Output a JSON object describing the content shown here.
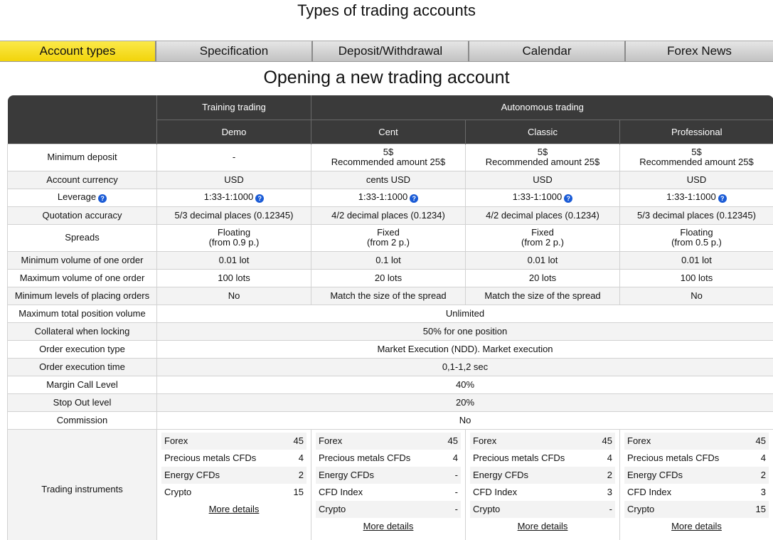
{
  "page_title": "Types of trading accounts",
  "tabs": [
    {
      "label": "Account types",
      "active": true
    },
    {
      "label": "Specification",
      "active": false
    },
    {
      "label": "Deposit/Withdrawal",
      "active": false
    },
    {
      "label": "Calendar",
      "active": false
    },
    {
      "label": "Forex News",
      "active": false
    }
  ],
  "section_title": "Opening a new trading account",
  "header": {
    "group_training": "Training trading",
    "group_autonomous": "Autonomous trading",
    "accounts": [
      "Demo",
      "Cent",
      "Classic",
      "Professional"
    ]
  },
  "rows": {
    "min_deposit": {
      "label": "Minimum deposit",
      "demo": "-",
      "cent_a": "5$",
      "cent_b": "Recommended amount 25$",
      "classic_a": "5$",
      "classic_b": "Recommended amount 25$",
      "pro_a": "5$",
      "pro_b": "Recommended amount 25$"
    },
    "currency": {
      "label": "Account currency",
      "demo": "USD",
      "cent": "cents USD",
      "classic": "USD",
      "pro": "USD"
    },
    "leverage": {
      "label": "Leverage",
      "demo": "1:33-1:1000",
      "cent": "1:33-1:1000",
      "classic": "1:33-1:1000",
      "pro": "1:33-1:1000"
    },
    "quotation": {
      "label": "Quotation accuracy",
      "demo": "5/3 decimal places (0.12345)",
      "cent": "4/2 decimal places (0.1234)",
      "classic": "4/2 decimal places (0.1234)",
      "pro": "5/3 decimal places (0.12345)"
    },
    "spreads": {
      "label": "Spreads",
      "demo_a": "Floating",
      "demo_b": "(from 0.9 p.)",
      "cent_a": "Fixed",
      "cent_b": "(from 2 p.)",
      "classic_a": "Fixed",
      "classic_b": "(from 2 p.)",
      "pro_a": "Floating",
      "pro_b": "(from 0.5 p.)"
    },
    "min_volume": {
      "label": "Minimum volume of one order",
      "demo": "0.01 lot",
      "cent": "0.1 lot",
      "classic": "0.01 lot",
      "pro": "0.01 lot"
    },
    "max_volume": {
      "label": "Maximum volume of one order",
      "demo": "100 lots",
      "cent": "20 lots",
      "classic": "20 lots",
      "pro": "100 lots"
    },
    "min_levels": {
      "label": "Minimum levels of placing orders",
      "demo": "No",
      "cent": "Match the size of the spread",
      "classic": "Match the size of the spread",
      "pro": "No"
    },
    "max_position": {
      "label": "Maximum total position volume",
      "value": "Unlimited"
    },
    "collateral": {
      "label": "Collateral when locking",
      "value": "50% for one position"
    },
    "exec_type": {
      "label": "Order execution type",
      "value": "Market Execution (NDD). Market execution"
    },
    "exec_time": {
      "label": "Order execution time",
      "value": "0,1-1,2 sec"
    },
    "margin_call": {
      "label": "Margin Call Level",
      "value": "40%"
    },
    "stop_out": {
      "label": "Stop Out level",
      "value": "20%"
    },
    "commission": {
      "label": "Commission",
      "value": "No"
    }
  },
  "instruments": {
    "label": "Trading instruments",
    "more_label": "More details",
    "demo": [
      {
        "name": "Forex",
        "count": "45"
      },
      {
        "name": "Precious metals CFDs",
        "count": "4"
      },
      {
        "name": "Energy CFDs",
        "count": "2"
      },
      {
        "name": "Crypto",
        "count": "15"
      }
    ],
    "cent": [
      {
        "name": "Forex",
        "count": "45"
      },
      {
        "name": "Precious metals CFDs",
        "count": "4"
      },
      {
        "name": "Energy CFDs",
        "count": "-"
      },
      {
        "name": "CFD Index",
        "count": "-"
      },
      {
        "name": "Crypto",
        "count": "-"
      }
    ],
    "classic": [
      {
        "name": "Forex",
        "count": "45"
      },
      {
        "name": "Precious metals CFDs",
        "count": "4"
      },
      {
        "name": "Energy CFDs",
        "count": "2"
      },
      {
        "name": "CFD Index",
        "count": "3"
      },
      {
        "name": "Crypto",
        "count": "-"
      }
    ],
    "pro": [
      {
        "name": "Forex",
        "count": "45"
      },
      {
        "name": "Precious metals CFDs",
        "count": "4"
      },
      {
        "name": "Energy CFDs",
        "count": "2"
      },
      {
        "name": "CFD Index",
        "count": "3"
      },
      {
        "name": "Crypto",
        "count": "15"
      }
    ]
  },
  "icons": {
    "help": "question-circle-icon",
    "help_color": "#1a5bd6"
  },
  "colors": {
    "active_tab": "#f2d40a",
    "header_bg": "#3a3a3a"
  }
}
